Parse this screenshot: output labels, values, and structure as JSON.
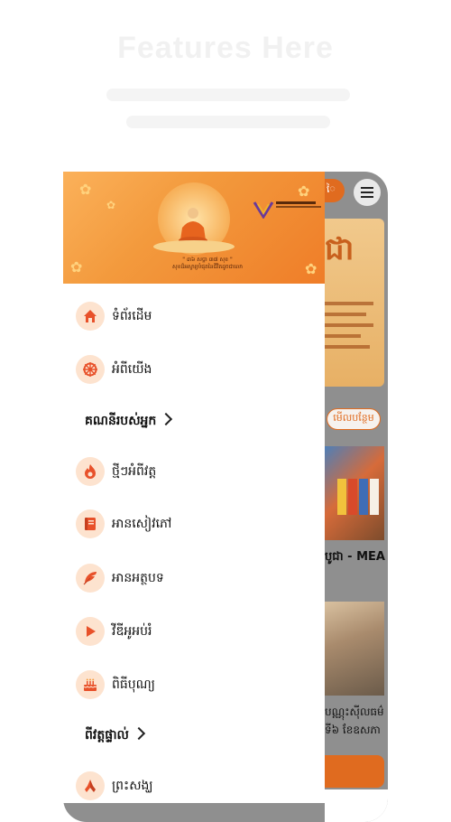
{
  "background": {
    "headline": "Features Here"
  },
  "app_screen": {
    "top_button_label": "ៃ",
    "see_more_label": "មើលបន្ថែម",
    "news": [
      {
        "title": "បូជា - MEA"
      },
      {
        "title_line1": "បណ្ណុះស៊ីលធម៌",
        "title_line2": "ទី៦ ខែឧសភា"
      }
    ]
  },
  "drawer": {
    "header": {
      "quote_line1": "\" ៣៦ សប្ដា ៣៧ សុខ \"",
      "quote_line2": "សុខដ៏អស្ចារ្យបំផុតនៃជីវិតដូចជាលោ"
    },
    "items": [
      {
        "label": "ទំព័រដើម",
        "icon": "home-icon"
      },
      {
        "label": "អំពីយើង",
        "icon": "dharma-wheel-icon"
      }
    ],
    "section_account": "គណនីរបស់អ្នក",
    "items2": [
      {
        "label": "ថ្មីៗអំពីវត្ត",
        "icon": "flame-icon"
      },
      {
        "label": "អានសៀវភៅ",
        "icon": "book-icon"
      },
      {
        "label": "អានអត្ថបទ",
        "icon": "feather-icon"
      },
      {
        "label": "វីឌីអូអប់រំ",
        "icon": "play-icon"
      },
      {
        "label": "ពិធីបុណ្យ",
        "icon": "cake-icon"
      }
    ],
    "section_temples": "ពីវត្តផ្ទាល់",
    "items3": [
      {
        "label": "ព្រះសង្ឃ",
        "icon": "praying-hands-icon"
      }
    ]
  },
  "colors": {
    "accent": "#e06b1f",
    "icon_bg": "#fde3cf",
    "icon_fg": "#e8512a"
  }
}
